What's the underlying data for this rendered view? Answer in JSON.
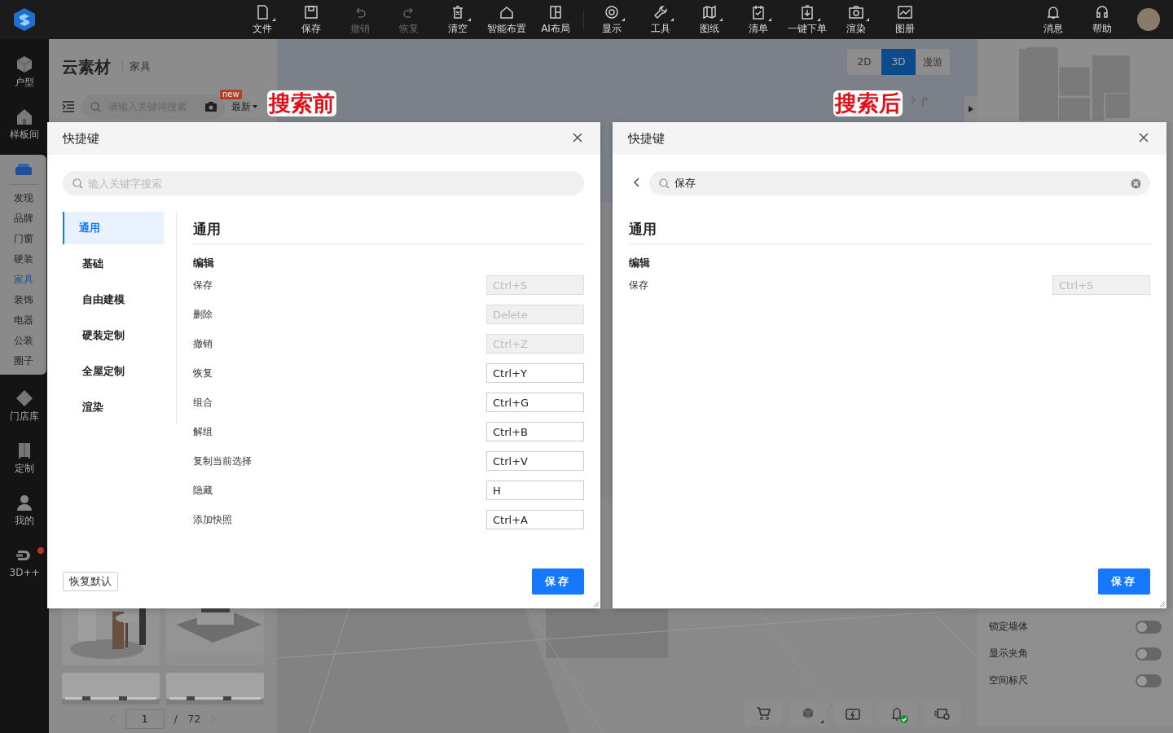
{
  "toolbar": {
    "items": [
      {
        "label": "文件",
        "disabled": false,
        "dropdown": true
      },
      {
        "label": "保存",
        "disabled": false,
        "dropdown": false
      },
      {
        "label": "撤销",
        "disabled": true,
        "dropdown": false
      },
      {
        "label": "恢复",
        "disabled": true,
        "dropdown": false
      },
      {
        "label": "清空",
        "disabled": false,
        "dropdown": true
      },
      {
        "label": "智能布置",
        "disabled": false,
        "dropdown": false
      },
      {
        "label": "AI布局",
        "disabled": false,
        "dropdown": false
      },
      {
        "label": "显示",
        "disabled": false,
        "dropdown": true
      },
      {
        "label": "工具",
        "disabled": false,
        "dropdown": true
      },
      {
        "label": "图纸",
        "disabled": false,
        "dropdown": true
      },
      {
        "label": "清单",
        "disabled": false,
        "dropdown": true
      },
      {
        "label": "一键下单",
        "disabled": false,
        "dropdown": true
      },
      {
        "label": "渲染",
        "disabled": false,
        "dropdown": true
      },
      {
        "label": "图册",
        "disabled": false,
        "dropdown": false
      }
    ],
    "right_items": [
      {
        "label": "消息"
      },
      {
        "label": "帮助"
      }
    ]
  },
  "sidebar": {
    "top_items": [
      {
        "label": "户型"
      },
      {
        "label": "样板间"
      }
    ],
    "material_items": [
      {
        "label": "发现",
        "selected": false
      },
      {
        "label": "品牌",
        "selected": false
      },
      {
        "label": "门窗",
        "selected": false
      },
      {
        "label": "硬装",
        "selected": false
      },
      {
        "label": "家具",
        "selected": true
      },
      {
        "label": "装饰",
        "selected": false
      },
      {
        "label": "电器",
        "selected": false
      },
      {
        "label": "公装",
        "selected": false
      },
      {
        "label": "圈子",
        "selected": false
      }
    ],
    "bottom_items": [
      {
        "label": "门店库",
        "notification": false
      },
      {
        "label": "定制",
        "notification": false
      },
      {
        "label": "我的",
        "notification": false
      },
      {
        "label": "3D++",
        "notification": true
      }
    ]
  },
  "material_panel": {
    "title": "云素材",
    "category": "家具",
    "search": {
      "placeholder": "请输入关键词搜索"
    },
    "new_badge": "new",
    "sort": "最新",
    "pagination": {
      "page": "1",
      "separator": "/",
      "total": "72"
    }
  },
  "view_modes": [
    {
      "label": "2D",
      "selected": false
    },
    {
      "label": "3D",
      "selected": true
    },
    {
      "label": "漫游",
      "selected": false
    }
  ],
  "settings": [
    {
      "label": "锁定墙体",
      "on": false
    },
    {
      "label": "显示夹角",
      "on": false
    },
    {
      "label": "空间标尺",
      "on": false
    }
  ],
  "bottom_tools": [
    {
      "dropdown": false,
      "checked": false
    },
    {
      "dropdown": true,
      "checked": false
    },
    {
      "dropdown": false,
      "checked": false
    },
    {
      "dropdown": false,
      "checked": true
    },
    {
      "dropdown": false,
      "checked": false
    }
  ],
  "annotations": [
    {
      "text": "搜索前"
    },
    {
      "text": "搜索后"
    }
  ],
  "dialogs": [
    {
      "title": "快捷键",
      "back_button": false,
      "search": {
        "placeholder": "输入关键字搜索"
      },
      "categories": [
        {
          "label": "通用",
          "selected": true
        },
        {
          "label": "基础",
          "selected": false
        },
        {
          "label": "自由建模",
          "selected": false
        },
        {
          "label": "硬装定制",
          "selected": false
        },
        {
          "label": "全屋定制",
          "selected": false
        },
        {
          "label": "渲染",
          "selected": false
        }
      ],
      "section": "通用",
      "groups": [
        {
          "title": "编辑",
          "shortcuts": [
            {
              "label": "保存",
              "key": "Ctrl+S",
              "disabled": true
            },
            {
              "label": "删除",
              "key": "Delete",
              "disabled": true
            },
            {
              "label": "撤销",
              "key": "Ctrl+Z",
              "disabled": true
            },
            {
              "label": "恢复",
              "key": "Ctrl+Y",
              "disabled": false
            },
            {
              "label": "组合",
              "key": "Ctrl+G",
              "disabled": false
            },
            {
              "label": "解组",
              "key": "Ctrl+B",
              "disabled": false
            },
            {
              "label": "复制当前选择",
              "key": "Ctrl+V",
              "disabled": false
            },
            {
              "label": "隐藏",
              "key": "H",
              "disabled": false
            },
            {
              "label": "添加快照",
              "key": "Ctrl+A",
              "disabled": false
            }
          ]
        }
      ],
      "buttons": [
        {
          "label": "恢复默认",
          "kind": "secondary"
        },
        {
          "label": "保存",
          "kind": "primary"
        }
      ]
    },
    {
      "title": "快捷键",
      "back_button": true,
      "search": {
        "value": "保存"
      },
      "section": "通用",
      "groups": [
        {
          "title": "编辑",
          "shortcuts": [
            {
              "label": "保存",
              "key": "Ctrl+S",
              "disabled": true
            }
          ]
        }
      ],
      "buttons": [
        {
          "label": "保存",
          "kind": "primary"
        }
      ]
    }
  ]
}
